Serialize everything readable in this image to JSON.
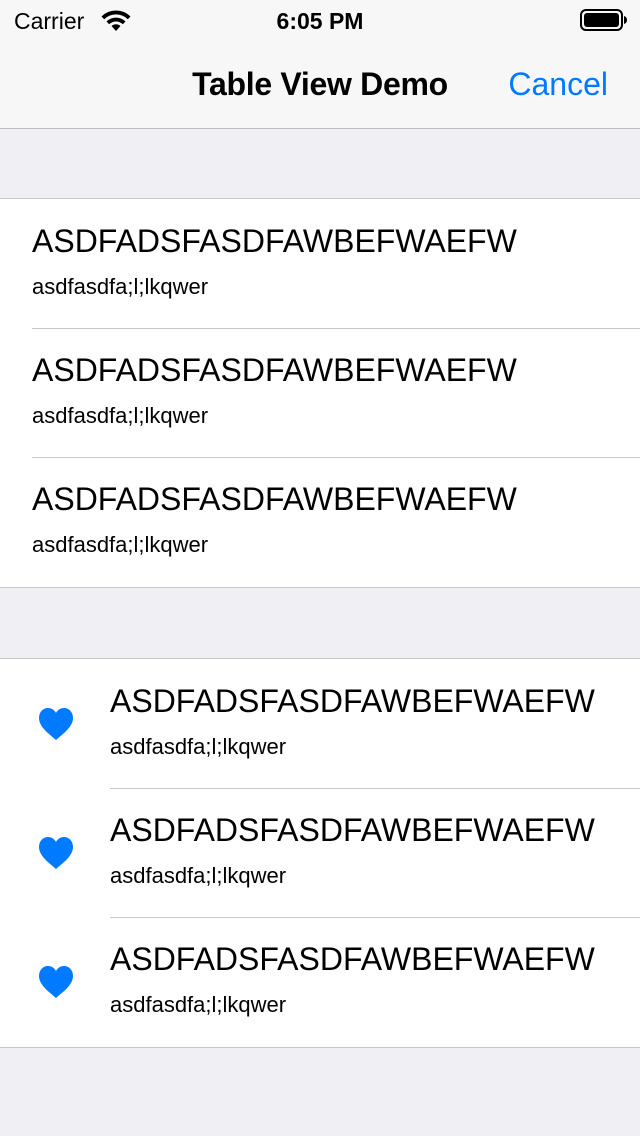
{
  "status_bar": {
    "carrier": "Carrier",
    "time": "6:05 PM"
  },
  "nav": {
    "title": "Table View Demo",
    "cancel_label": "Cancel"
  },
  "colors": {
    "accent": "#007aff"
  },
  "section1": {
    "rows": [
      {
        "title": "ASDFADSFASDFAWBEFWAEFW",
        "subtitle": "asdfasdfa;l;lkqwer"
      },
      {
        "title": "ASDFADSFASDFAWBEFWAEFW",
        "subtitle": "asdfasdfa;l;lkqwer"
      },
      {
        "title": "ASDFADSFASDFAWBEFWAEFW",
        "subtitle": "asdfasdfa;l;lkqwer"
      }
    ]
  },
  "section2": {
    "icon": "heart-icon",
    "rows": [
      {
        "title": "ASDFADSFASDFAWBEFWAEFW",
        "subtitle": "asdfasdfa;l;lkqwer"
      },
      {
        "title": "ASDFADSFASDFAWBEFWAEFW",
        "subtitle": "asdfasdfa;l;lkqwer"
      },
      {
        "title": "ASDFADSFASDFAWBEFWAEFW",
        "subtitle": "asdfasdfa;l;lkqwer"
      }
    ]
  }
}
